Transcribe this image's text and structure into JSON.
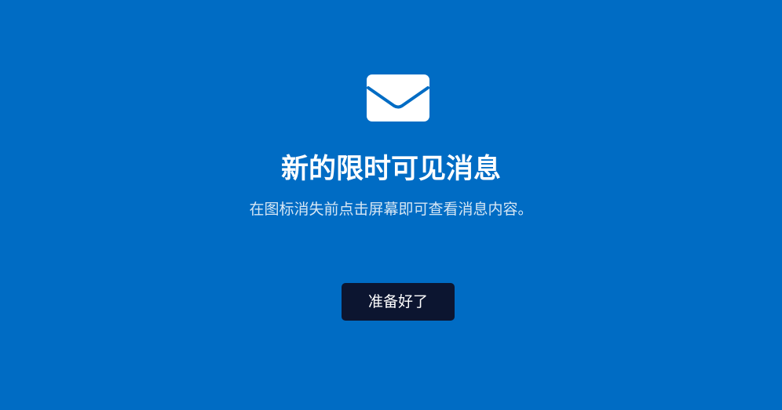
{
  "dialog": {
    "icon": "envelope-icon",
    "title": "新的限时可见消息",
    "description": "在图标消失前点击屏幕即可查看消息内容。",
    "ready_button_label": "准备好了"
  },
  "colors": {
    "background": "#006cc4",
    "icon": "#ffffff",
    "button_background": "#0c1530",
    "button_text": "#ffffff"
  }
}
